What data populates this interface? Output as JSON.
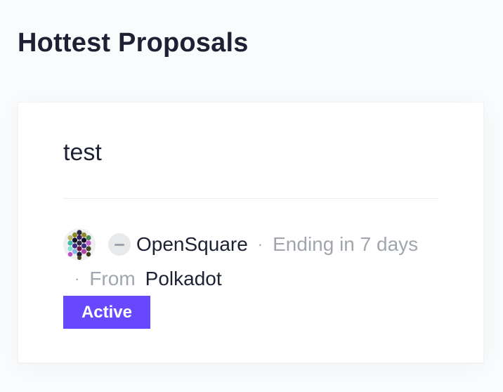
{
  "section": {
    "title": "Hottest Proposals"
  },
  "proposal": {
    "title": "test",
    "author": "OpenSquare",
    "avatar_icon": "identicon-avatar",
    "network_icon": "network-placeholder-icon",
    "separator": "·",
    "ending": "Ending in 7 days",
    "from_label": "From",
    "from_value": "Polkadot",
    "status": "Active",
    "status_color": "#6848ff"
  },
  "colors": {
    "background": "#fafbfc",
    "card": "#ffffff",
    "text_primary": "#1e2134",
    "text_secondary": "#a1a6ae",
    "accent": "#6848ff"
  }
}
